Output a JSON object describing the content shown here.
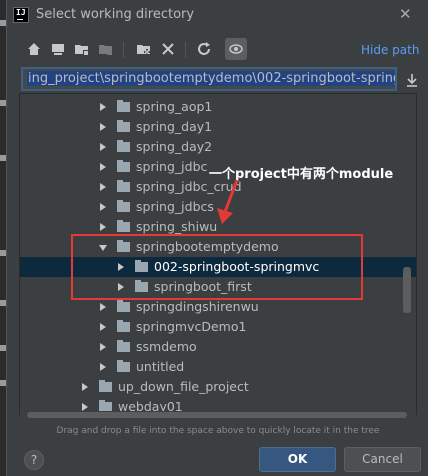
{
  "window": {
    "title": "Select working directory",
    "app_icon_text": "IJ"
  },
  "toolbar": {
    "icons": [
      "home-icon",
      "desktop-icon",
      "project-folder-icon",
      "module-folder-icon",
      "new-folder-icon",
      "delete-icon",
      "refresh-icon",
      "show-hidden-icon"
    ],
    "hide_path_label": "Hide path"
  },
  "path": {
    "value": "ing_project\\springbootemptydemo\\002-springboot-springmvc"
  },
  "tree": {
    "rows": [
      {
        "label": "spring_aop1",
        "expanded": false
      },
      {
        "label": "spring_day1",
        "expanded": false
      },
      {
        "label": "spring_day2",
        "expanded": false
      },
      {
        "label": "spring_jdbc",
        "expanded": false
      },
      {
        "label": "spring_jdbc_crud",
        "expanded": false
      },
      {
        "label": "spring_jdbcs",
        "expanded": false
      },
      {
        "label": "spring_shiwu",
        "expanded": false
      },
      {
        "label": "springbootemptydemo",
        "expanded": true
      },
      {
        "label": "002-springboot-springmvc",
        "expanded": false,
        "selected": true
      },
      {
        "label": "springboot_first",
        "expanded": false
      },
      {
        "label": "springdingshirenwu",
        "expanded": false
      },
      {
        "label": "springmvcDemo1",
        "expanded": false
      },
      {
        "label": "ssmdemo",
        "expanded": false
      },
      {
        "label": "untitled",
        "expanded": false
      },
      {
        "label": "up_down_file_project",
        "expanded": false
      },
      {
        "label": "webday01",
        "expanded": false
      }
    ]
  },
  "annotation": {
    "text": "一个project中有两个module",
    "color": "#e53935"
  },
  "hint": "Drag and drop a file into the space above to quickly locate it in the tree",
  "buttons": {
    "help": "?",
    "ok": "OK",
    "cancel": "Cancel"
  },
  "colors": {
    "accent": "#589df6",
    "selection": "#0d293e",
    "ok_button": "#365880"
  }
}
